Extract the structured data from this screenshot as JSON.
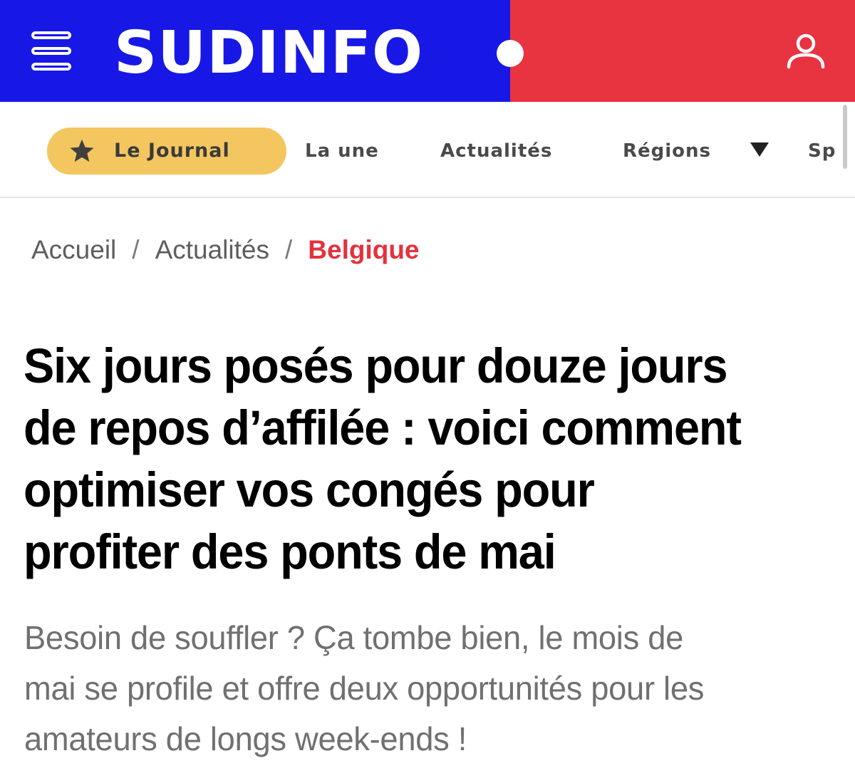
{
  "brand": {
    "logo_text": "SUDINFO",
    "colors": {
      "primary_blue": "#1818e6",
      "primary_red": "#e83340",
      "pill_yellow": "#f4c65f",
      "breadcrumb_active": "#e3323c"
    }
  },
  "header": {
    "menu_icon": "hamburger-menu-icon",
    "user_icon": "user-account-icon"
  },
  "nav": {
    "featured": {
      "label": "Le Journal",
      "icon": "star-icon"
    },
    "items": [
      {
        "label": "La une"
      },
      {
        "label": "Actualités"
      },
      {
        "label": "Régions",
        "icon": "caret-down-icon"
      },
      {
        "label": "Sp"
      }
    ]
  },
  "breadcrumb": {
    "items": [
      "Accueil",
      "Actualités",
      "Belgique"
    ],
    "separator": "/"
  },
  "article": {
    "headline_lines": [
      "Six jours posés pour douze jours",
      "de repos d’affilée : voici comment",
      "optimiser vos congés pour",
      "profiter des ponts de mai"
    ],
    "lead_lines": [
      "Besoin de souffler ? Ça tombe bien, le mois de",
      "mai se profile et offre deux opportunités pour les",
      "amateurs de longs week-ends !"
    ]
  }
}
